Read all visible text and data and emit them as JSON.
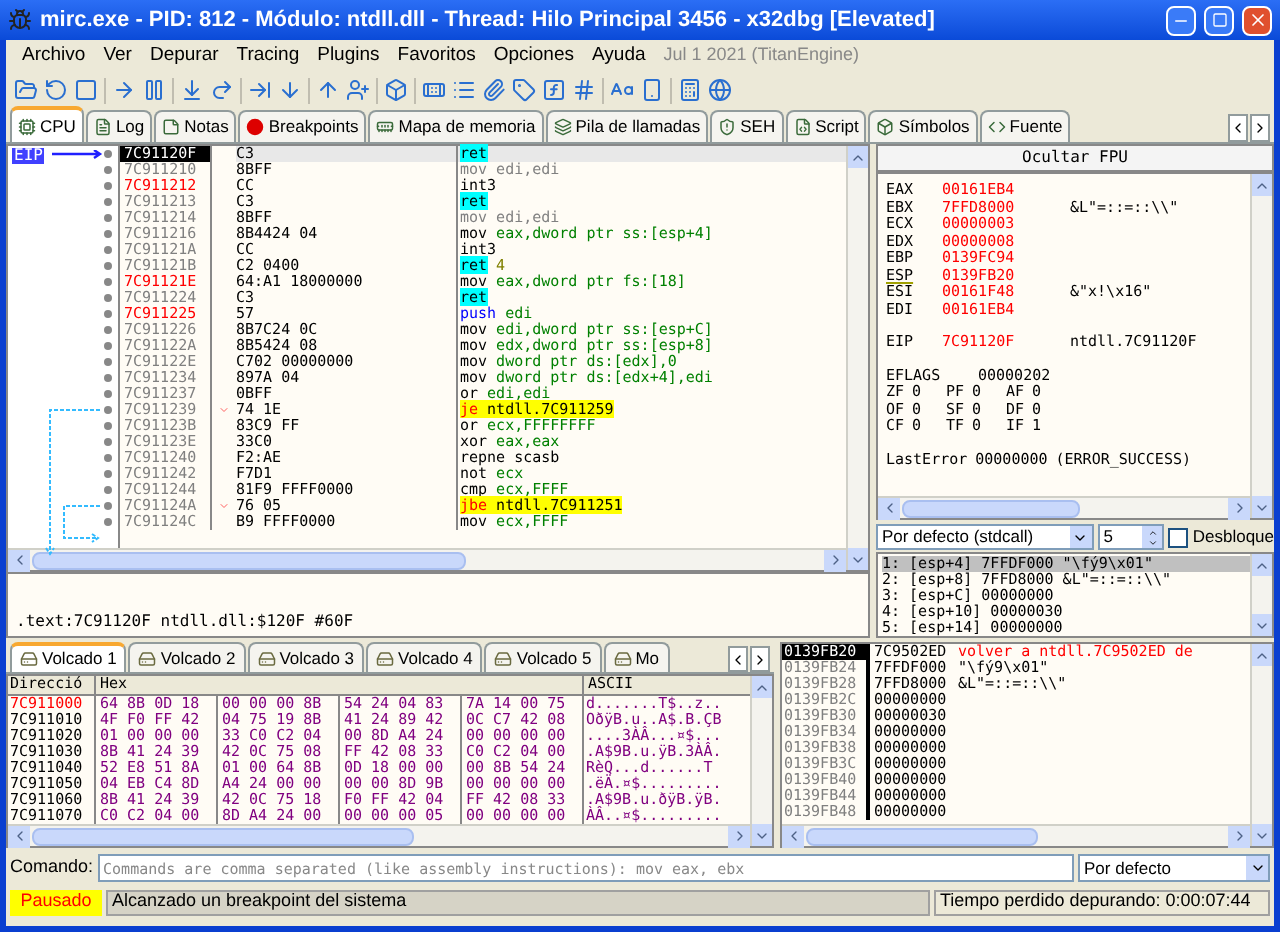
{
  "window": {
    "title": "mirc.exe - PID: 812 - Módulo: ntdll.dll - Thread: Hilo Principal 3456 - x32dbg [Elevated]"
  },
  "menu": [
    "Archivo",
    "Ver",
    "Depurar",
    "Tracing",
    "Plugins",
    "Favoritos",
    "Opciones",
    "Ayuda"
  ],
  "build_info": "Jul 1 2021 (TitanEngine)",
  "tabs": [
    {
      "label": "CPU",
      "selected": true
    },
    {
      "label": "Log",
      "selected": false
    },
    {
      "label": "Notas",
      "selected": false
    },
    {
      "label": "Breakpoints",
      "selected": false
    },
    {
      "label": "Mapa de memoria",
      "selected": false
    },
    {
      "label": "Pila de llamadas",
      "selected": false
    },
    {
      "label": "SEH",
      "selected": false
    },
    {
      "label": "Script",
      "selected": false
    },
    {
      "label": "Símbolos",
      "selected": false
    },
    {
      "label": "Fuente",
      "selected": false
    }
  ],
  "disassembly": {
    "eip_label": "EIP",
    "rows": [
      {
        "address": "7C91120F",
        "bytes": "C3",
        "mnemonic": "ret",
        "kind": "ret",
        "highlighted": false,
        "selected": true
      },
      {
        "address": "7C911210",
        "bytes": "8BFF",
        "mnemonic": "mov",
        "operands": "edi,edi",
        "kind": "nop",
        "highlighted": false,
        "selected": false
      },
      {
        "address": "7C911212",
        "bytes": "CC",
        "mnemonic": "int3",
        "kind": "normal",
        "highlighted": true,
        "selected": false
      },
      {
        "address": "7C911213",
        "bytes": "C3",
        "mnemonic": "ret",
        "kind": "ret",
        "highlighted": false,
        "selected": false
      },
      {
        "address": "7C911214",
        "bytes": "8BFF",
        "mnemonic": "mov",
        "operands": "edi,edi",
        "kind": "nop",
        "highlighted": false,
        "selected": false
      },
      {
        "address": "7C911216",
        "bytes": "8B4424 04",
        "mnemonic": "mov",
        "operands": "eax,dword ptr ss:[esp+4]",
        "kind": "normal",
        "highlighted": false,
        "selected": false
      },
      {
        "address": "7C91121A",
        "bytes": "CC",
        "mnemonic": "int3",
        "kind": "normal",
        "highlighted": false,
        "selected": false
      },
      {
        "address": "7C91121B",
        "bytes": "C2 0400",
        "mnemonic": "ret",
        "operands": "4",
        "kind": "ret",
        "highlighted": false,
        "selected": false
      },
      {
        "address": "7C91121E",
        "bytes": "64:A1 18000000",
        "mnemonic": "mov",
        "operands": "eax,dword ptr fs:[18]",
        "kind": "normal",
        "highlighted": true,
        "selected": false
      },
      {
        "address": "7C911224",
        "bytes": "C3",
        "mnemonic": "ret",
        "kind": "ret",
        "highlighted": false,
        "selected": false
      },
      {
        "address": "7C911225",
        "bytes": "57",
        "mnemonic": "push",
        "operands": "edi",
        "kind": "push",
        "highlighted": true,
        "selected": false
      },
      {
        "address": "7C911226",
        "bytes": "8B7C24 0C",
        "mnemonic": "mov",
        "operands": "edi,dword ptr ss:[esp+C]",
        "kind": "normal",
        "highlighted": false,
        "selected": false
      },
      {
        "address": "7C91122A",
        "bytes": "8B5424 08",
        "mnemonic": "mov",
        "operands": "edx,dword ptr ss:[esp+8]",
        "kind": "normal",
        "highlighted": false,
        "selected": false
      },
      {
        "address": "7C91122E",
        "bytes": "C702 00000000",
        "mnemonic": "mov",
        "operands": "dword ptr ds:[edx],0",
        "kind": "normal",
        "highlighted": false,
        "selected": false
      },
      {
        "address": "7C911234",
        "bytes": "897A 04",
        "mnemonic": "mov",
        "operands": "dword ptr ds:[edx+4],edi",
        "kind": "normal",
        "highlighted": false,
        "selected": false
      },
      {
        "address": "7C911237",
        "bytes": "0BFF",
        "mnemonic": "or",
        "operands": "edi,edi",
        "kind": "normal",
        "highlighted": false,
        "selected": false
      },
      {
        "address": "7C911239",
        "bytes": "74 1E",
        "mnemonic": "je",
        "operands": "ntdll.7C911259",
        "kind": "jump",
        "highlighted": false,
        "selected": false
      },
      {
        "address": "7C91123B",
        "bytes": "83C9 FF",
        "mnemonic": "or",
        "operands": "ecx,FFFFFFFF",
        "kind": "normal",
        "highlighted": false,
        "selected": false
      },
      {
        "address": "7C91123E",
        "bytes": "33C0",
        "mnemonic": "xor",
        "operands": "eax,eax",
        "kind": "normal",
        "highlighted": false,
        "selected": false
      },
      {
        "address": "7C911240",
        "bytes": "F2:AE",
        "mnemonic": "repne scasb",
        "kind": "normal",
        "highlighted": false,
        "selected": false
      },
      {
        "address": "7C911242",
        "bytes": "F7D1",
        "mnemonic": "not",
        "operands": "ecx",
        "kind": "normal",
        "highlighted": false,
        "selected": false
      },
      {
        "address": "7C911244",
        "bytes": "81F9 FFFF0000",
        "mnemonic": "cmp",
        "operands": "ecx,FFFF",
        "kind": "normal",
        "highlighted": false,
        "selected": false
      },
      {
        "address": "7C91124A",
        "bytes": "76 05",
        "mnemonic": "jbe",
        "operands": "ntdll.7C911251",
        "kind": "jump",
        "highlighted": false,
        "selected": false
      },
      {
        "address": "7C91124C",
        "bytes": "B9 FFFF0000",
        "mnemonic": "mov",
        "operands": "ecx,FFFF",
        "kind": "normal",
        "highlighted": false,
        "selected": false
      }
    ]
  },
  "info_line": ".text:7C91120F ntdll.dll:$120F #60F",
  "registers": {
    "fpu_button": "Ocultar FPU",
    "general": [
      {
        "name": "EAX",
        "value": "00161EB4",
        "changed": true,
        "underlined": false
      },
      {
        "name": "EBX",
        "value": "7FFD8000",
        "comment": "&L\"=::=::\\\\\"",
        "changed": true,
        "underlined": false
      },
      {
        "name": "ECX",
        "value": "00000003",
        "changed": true,
        "underlined": false
      },
      {
        "name": "EDX",
        "value": "00000008",
        "changed": true,
        "underlined": false
      },
      {
        "name": "EBP",
        "value": "0139FC94",
        "changed": true,
        "underlined": false
      },
      {
        "name": "ESP",
        "value": "0139FB20",
        "changed": true,
        "underlined": true
      },
      {
        "name": "ESI",
        "value": "00161F48",
        "comment": "&\"x!\\x16\"",
        "changed": true,
        "underlined": false
      },
      {
        "name": "EDI",
        "value": "00161EB4",
        "changed": true,
        "underlined": false
      }
    ],
    "eip": {
      "name": "EIP",
      "value": "7C91120F",
      "comment": "ntdll.7C91120F",
      "changed": true
    },
    "eflags": {
      "name": "EFLAGS",
      "value": "00000202"
    },
    "flags": [
      {
        "name": "ZF",
        "value": "0"
      },
      {
        "name": "PF",
        "value": "0"
      },
      {
        "name": "AF",
        "value": "0"
      },
      {
        "name": "OF",
        "value": "0"
      },
      {
        "name": "SF",
        "value": "0"
      },
      {
        "name": "DF",
        "value": "0"
      },
      {
        "name": "CF",
        "value": "0"
      },
      {
        "name": "TF",
        "value": "0"
      },
      {
        "name": "IF",
        "value": "1"
      }
    ],
    "last_error": {
      "name": "LastError",
      "value": "00000000",
      "comment": "(ERROR_SUCCESS)"
    }
  },
  "call_convention": {
    "value": "Por defecto (stdcall)",
    "count": "5",
    "unlock": {
      "label": "Desbloque",
      "checked": false
    }
  },
  "arguments": [
    {
      "text": "1: [esp+4] 7FFDF000 \"\\fý9\\x01\"",
      "selected": true
    },
    {
      "text": "2: [esp+8] 7FFD8000 &L\"=::=::\\\\\"",
      "selected": false
    },
    {
      "text": "3: [esp+C] 00000000",
      "selected": false
    },
    {
      "text": "4: [esp+10] 00000030",
      "selected": false
    },
    {
      "text": "5: [esp+14] 00000000",
      "selected": false
    }
  ],
  "dump_tabs": [
    {
      "label": "Volcado 1",
      "selected": true
    },
    {
      "label": "Volcado 2",
      "selected": false
    },
    {
      "label": "Volcado 3",
      "selected": false
    },
    {
      "label": "Volcado 4",
      "selected": false
    },
    {
      "label": "Volcado 5",
      "selected": false
    },
    {
      "label": "Mo",
      "selected": false
    }
  ],
  "dump": {
    "columns": [
      "Direcció",
      "Hex",
      "ASCII"
    ],
    "rows": [
      {
        "address": "7C911000",
        "hex": [
          "64 8B 0D 18",
          "00 00 00 8B",
          "54 24 04 83",
          "7A 14 00 75"
        ],
        "ascii": "d.......T$..z..",
        "selected": true
      },
      {
        "address": "7C911010",
        "hex": [
          "4F F0 FF 42",
          "04 75 19 8B",
          "41 24 89 42",
          "0C C7 42 08"
        ],
        "ascii": "OðÿB.u..A$.B.ÇB",
        "selected": false
      },
      {
        "address": "7C911020",
        "hex": [
          "01 00 00 00",
          "33 C0 C2 04",
          "00 8D A4 24",
          "00 00 00 00"
        ],
        "ascii": "....3ÀÂ...¤$...",
        "selected": false
      },
      {
        "address": "7C911030",
        "hex": [
          "8B 41 24 39",
          "42 0C 75 08",
          "FF 42 08 33",
          "C0 C2 04 00"
        ],
        "ascii": ".A$9B.u.ÿB.3ÀÂ.",
        "selected": false
      },
      {
        "address": "7C911040",
        "hex": [
          "52 E8 51 8A",
          "01 00 64 8B",
          "0D 18 00 00",
          "00 8B 54 24"
        ],
        "ascii": "RèQ...d......T",
        "selected": false
      },
      {
        "address": "7C911050",
        "hex": [
          "04 EB C4 8D",
          "A4 24 00 00",
          "00 00 8D 9B",
          "00 00 00 00"
        ],
        "ascii": ".ëÄ.¤$.........",
        "selected": false
      },
      {
        "address": "7C911060",
        "hex": [
          "8B 41 24 39",
          "42 0C 75 18",
          "F0 FF 42 04",
          "FF 42 08 33"
        ],
        "ascii": ".A$9B.u.ðÿB.ÿB.",
        "selected": false
      },
      {
        "address": "7C911070",
        "hex": [
          "C0 C2 04 00",
          "8D A4 24 00",
          "00 00 00 05",
          "00 00 00 00"
        ],
        "ascii": "ÀÂ..¤$.........",
        "selected": false
      }
    ]
  },
  "stack": [
    {
      "address": "0139FB20",
      "value": "7C9502ED",
      "comment": "volver a ntdll.7C9502ED de",
      "selected": true
    },
    {
      "address": "0139FB24",
      "value": "7FFDF000",
      "comment": "\"\\fý9\\x01\"",
      "selected": false
    },
    {
      "address": "0139FB28",
      "value": "7FFD8000",
      "comment": "&L\"=::=::\\\\\"",
      "selected": false
    },
    {
      "address": "0139FB2C",
      "value": "00000000",
      "selected": false
    },
    {
      "address": "0139FB30",
      "value": "00000030",
      "selected": false
    },
    {
      "address": "0139FB34",
      "value": "00000000",
      "selected": false
    },
    {
      "address": "0139FB38",
      "value": "00000000",
      "selected": false
    },
    {
      "address": "0139FB3C",
      "value": "00000000",
      "selected": false
    },
    {
      "address": "0139FB40",
      "value": "00000000",
      "selected": false
    },
    {
      "address": "0139FB44",
      "value": "00000000",
      "selected": false
    },
    {
      "address": "0139FB48",
      "value": "00000000",
      "selected": false
    }
  ],
  "command": {
    "label": "Comando:",
    "placeholder": "Commands are comma separated (like assembly instructions): mov eax, ebx",
    "mode": "Por defecto"
  },
  "status_bar": {
    "state": "Pausado",
    "message": "Alcanzado un breakpoint del sistema",
    "elapsed": "Tiempo perdido depurando: 0:00:07:44"
  }
}
